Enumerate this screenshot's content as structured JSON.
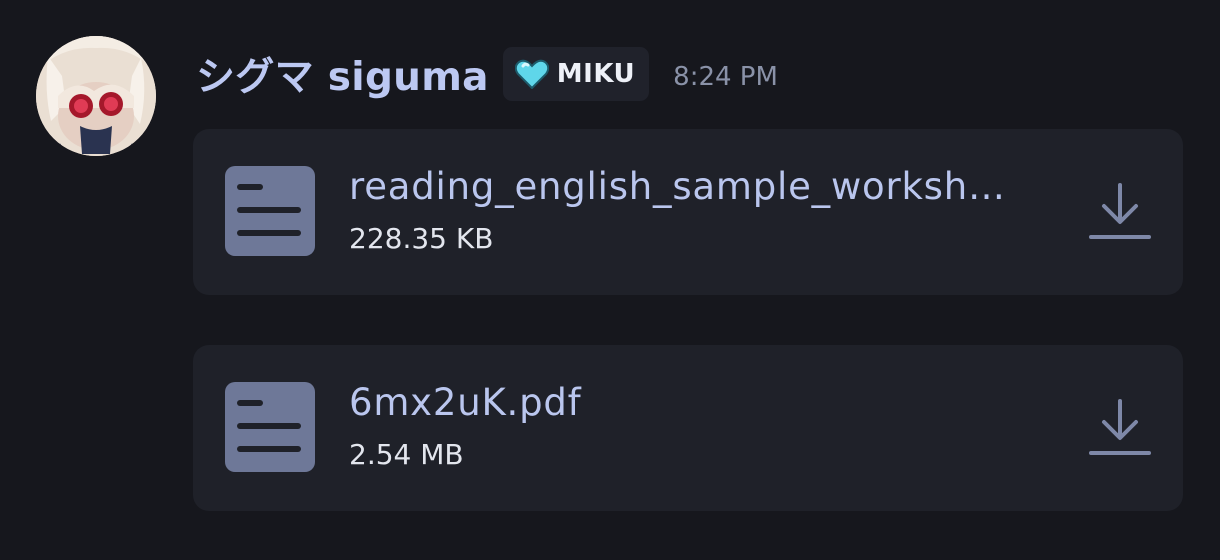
{
  "message": {
    "display_name": "シグマ siguma",
    "badge": {
      "icon": "cyan-heart-icon",
      "label": "MIKU",
      "color": "#5fd6ea"
    },
    "timestamp": "8:24 PM"
  },
  "attachments": [
    {
      "file_name": "reading_english_sample_worksh…",
      "file_size": "228.35 KB",
      "file_icon": "document-icon",
      "action_icon": "download-icon"
    },
    {
      "file_name": "6mx2uK.pdf",
      "file_size": "2.54 MB",
      "file_icon": "document-icon",
      "action_icon": "download-icon"
    }
  ],
  "colors": {
    "background": "#16171d",
    "card": "#1f2129",
    "username": "#bcc8f2",
    "file_name": "#bac6ee",
    "icon": "#6e7898"
  }
}
